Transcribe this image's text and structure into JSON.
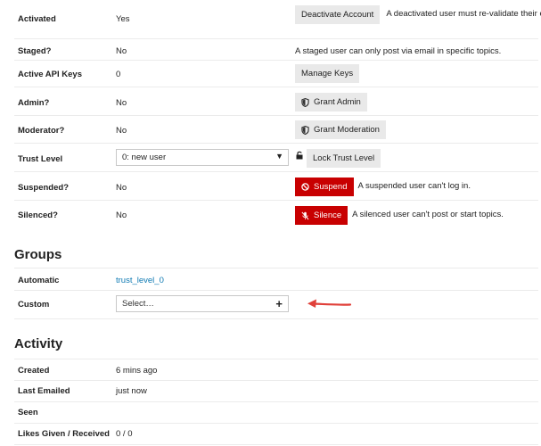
{
  "rows": {
    "activated": {
      "label": "Activated",
      "value": "Yes",
      "button": "Deactivate Account",
      "note": "A deactivated user must re-validate their email."
    },
    "staged": {
      "label": "Staged?",
      "value": "No",
      "note": "A staged user can only post via email in specific topics."
    },
    "api_keys": {
      "label": "Active API Keys",
      "value": "0",
      "button": "Manage Keys"
    },
    "admin": {
      "label": "Admin?",
      "value": "No",
      "button": "Grant Admin",
      "icon": "shield-icon"
    },
    "moderator": {
      "label": "Moderator?",
      "value": "No",
      "button": "Grant Moderation",
      "icon": "shield-icon"
    },
    "trust_level": {
      "label": "Trust Level",
      "selected": "0: new user",
      "button": "Lock Trust Level",
      "icon": "unlock-icon"
    },
    "suspended": {
      "label": "Suspended?",
      "value": "No",
      "button": "Suspend",
      "note": "A suspended user can't log in.",
      "icon": "ban-icon"
    },
    "silenced": {
      "label": "Silenced?",
      "value": "No",
      "button": "Silence",
      "note": "A silenced user can't post or start topics.",
      "icon": "microphone-slash-icon"
    }
  },
  "groups": {
    "title": "Groups",
    "automatic_label": "Automatic",
    "automatic_value": "trust_level_0",
    "custom_label": "Custom",
    "custom_placeholder": "Select…",
    "annotation": "red-arrow-pointing-left"
  },
  "activity": {
    "title": "Activity",
    "created_label": "Created",
    "created_value": "6 mins ago",
    "emailed_label": "Last Emailed",
    "emailed_value": "just now",
    "seen_label": "Seen",
    "seen_value": "",
    "likes_label": "Likes Given / Received",
    "likes_value": "0 / 0"
  },
  "colors": {
    "danger": "#c80001",
    "link": "#0f7ab3",
    "button_bg": "#e9e9e9",
    "arrow": "#e0403a"
  }
}
